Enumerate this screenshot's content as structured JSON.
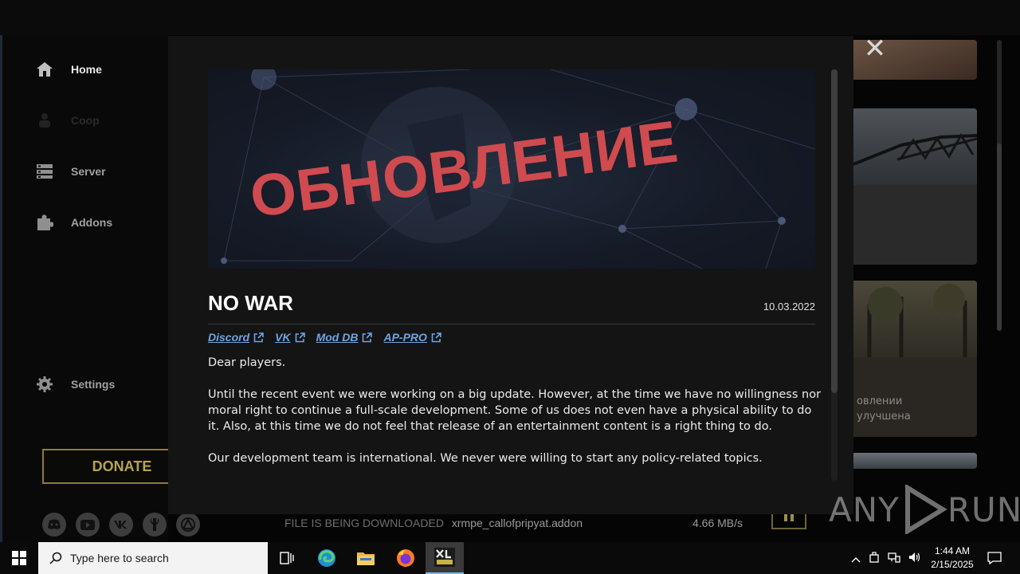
{
  "sidebar": {
    "items": [
      {
        "label": "Home",
        "icon": "home-icon"
      },
      {
        "label": "Coop",
        "icon": "coop-icon"
      },
      {
        "label": "Server",
        "icon": "server-icon"
      },
      {
        "label": "Addons",
        "icon": "puzzle-icon"
      }
    ],
    "settings_label": "Settings",
    "donate_label": "DONATE",
    "social_icons": [
      "discord-icon",
      "youtube-icon",
      "vk-icon",
      "wrench-icon",
      "stalker-icon"
    ]
  },
  "cards": {
    "card3_line1": "овлении",
    "card3_line2": "улучшена"
  },
  "download": {
    "status": "FILE IS BEING DOWNLOADED",
    "file": "xrmpe_callofpripyat.addon",
    "speed": "4.66 MB/s"
  },
  "modal": {
    "banner_text": "ОБНОВЛЕНИЕ",
    "title": "NO WAR",
    "date": "10.03.2022",
    "links": [
      "Discord",
      "VK",
      "Mod DB",
      "AP-PRO"
    ],
    "paragraphs": [
      "Dear players.",
      "Until the recent event we were working on a big update. However, at the time we have no willingness nor moral right to continue a full-scale development. Some of us does not even have a physical ability to do it. Also, at this time we do not feel that release of an entertainment content is a right thing to do.",
      "Our development team is international. We never were willing to start any policy-related topics."
    ],
    "close_icon": "close-icon"
  },
  "watermark": {
    "text_left": "ANY",
    "text_right": "RUN"
  },
  "taskbar": {
    "search_placeholder": "Type here to search",
    "time": "1:44 AM",
    "date": "2/15/2025"
  },
  "colors": {
    "accent_gold": "#b5a34f",
    "banner_red": "#cf4b4f",
    "link_blue": "#6ea4e0"
  }
}
